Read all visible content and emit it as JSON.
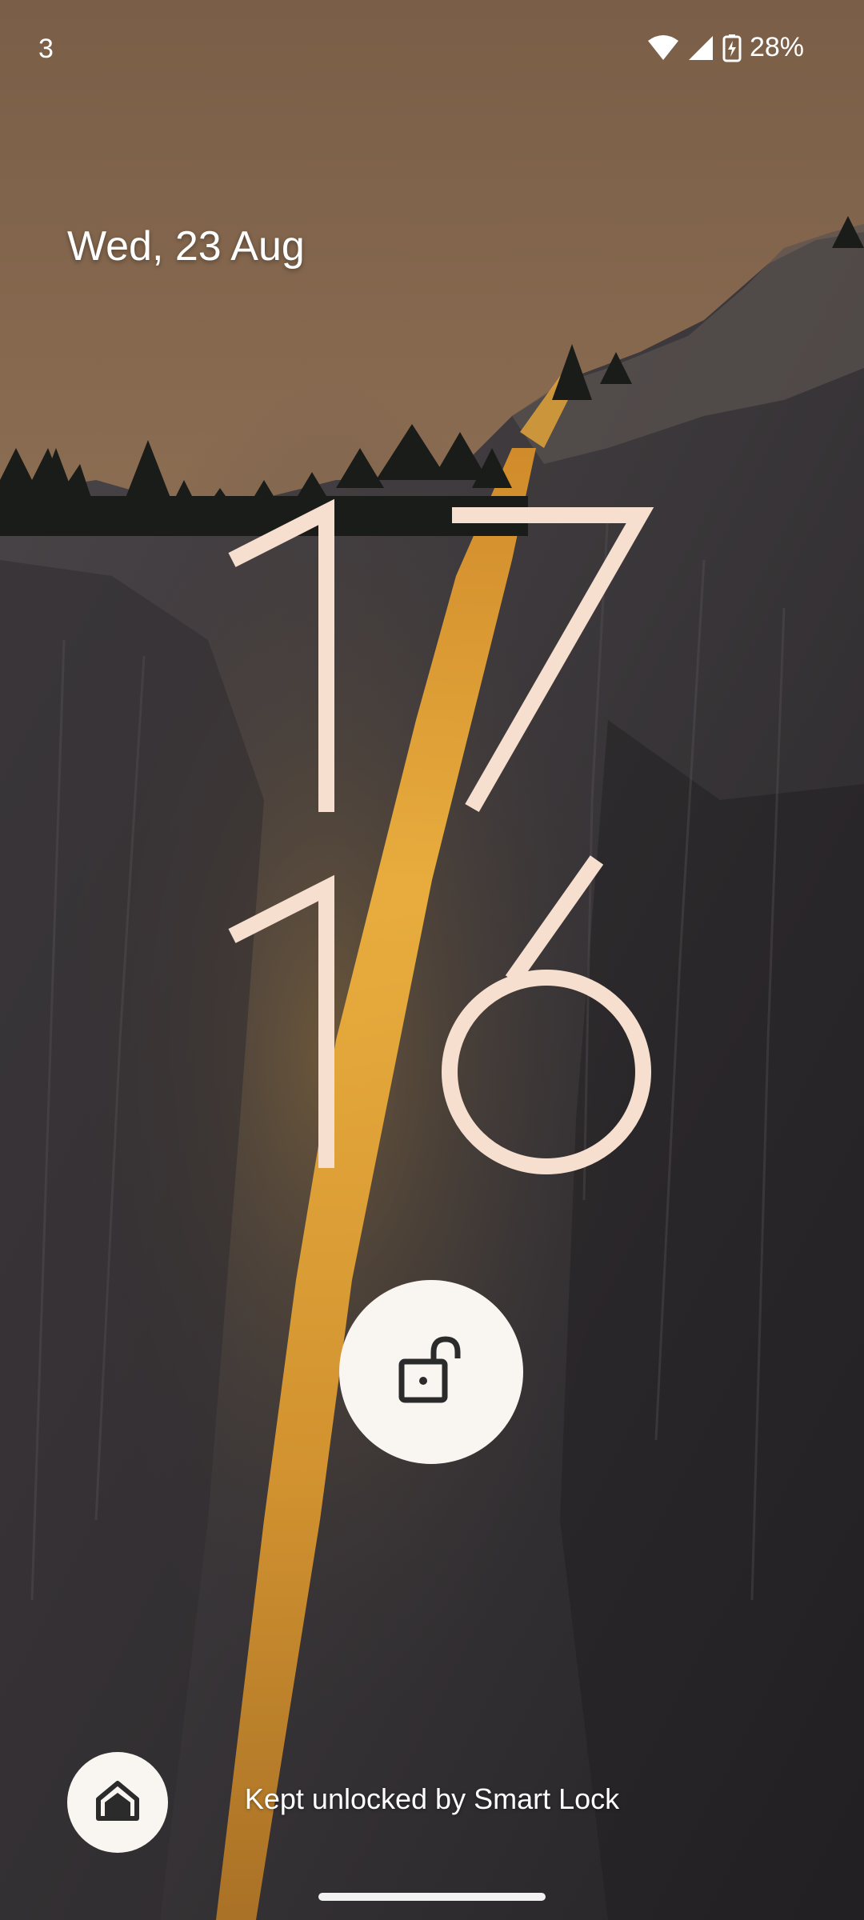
{
  "status_bar": {
    "notification_count": "3",
    "battery_percent": "28%"
  },
  "lockscreen": {
    "date": "Wed, 23 Aug",
    "clock_hours": "17",
    "clock_minutes": "16",
    "smart_lock_message": "Kept unlocked by Smart Lock"
  },
  "colors": {
    "clock": "#f6dfcf",
    "button_background": "#f9f5f1",
    "icon": "#2b2b2b"
  },
  "icons": {
    "status": [
      "wifi-icon",
      "cellular-signal-icon",
      "battery-charging-icon"
    ],
    "lock_button": "unlocked-padlock-icon",
    "home_shortcut": "home-icon"
  }
}
